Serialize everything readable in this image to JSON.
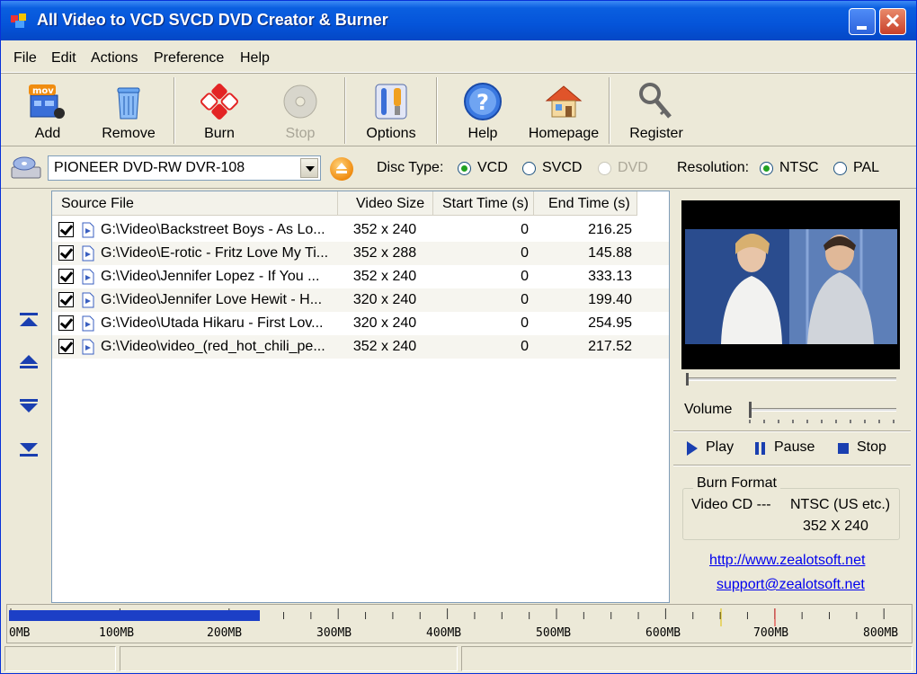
{
  "window": {
    "title": "All Video to VCD SVCD DVD Creator & Burner"
  },
  "menu": [
    {
      "label": "File"
    },
    {
      "label": "Edit"
    },
    {
      "label": "Actions"
    },
    {
      "label": "Preference"
    },
    {
      "label": "Help"
    }
  ],
  "toolbar": {
    "add": "Add",
    "remove": "Remove",
    "burn": "Burn",
    "stop": "Stop",
    "options": "Options",
    "help": "Help",
    "homepage": "Homepage",
    "register": "Register"
  },
  "drive": {
    "selected": "PIONEER  DVD-RW  DVR-108",
    "disc_type_label": "Disc Type:",
    "disc_types": [
      "VCD",
      "SVCD",
      "DVD"
    ],
    "disc_type_selected": "VCD",
    "resolution_label": "Resolution:",
    "resolutions": [
      "NTSC",
      "PAL"
    ],
    "resolution_selected": "NTSC"
  },
  "list": {
    "columns": [
      "Source File",
      "Video Size",
      "Start Time (s)",
      "End Time (s)"
    ],
    "rows": [
      {
        "source": "G:\\Video\\Backstreet Boys - As Lo...",
        "size": "352 x 240",
        "start": "0",
        "end": "216.25",
        "checked": true
      },
      {
        "source": "G:\\Video\\E-rotic - Fritz Love My Ti...",
        "size": "352 x 288",
        "start": "0",
        "end": "145.88",
        "checked": true
      },
      {
        "source": "G:\\Video\\Jennifer Lopez - If You ...",
        "size": "352 x 240",
        "start": "0",
        "end": "333.13",
        "checked": true
      },
      {
        "source": "G:\\Video\\Jennifer Love Hewit - H...",
        "size": "320 x 240",
        "start": "0",
        "end": "199.40",
        "checked": true
      },
      {
        "source": "G:\\Video\\Utada Hikaru - First Lov...",
        "size": "320 x 240",
        "start": "0",
        "end": "254.95",
        "checked": true
      },
      {
        "source": "G:\\Video\\video_(red_hot_chili_pe...",
        "size": "352 x 240",
        "start": "0",
        "end": "217.52",
        "checked": true
      }
    ]
  },
  "player": {
    "volume_label": "Volume",
    "play": "Play",
    "pause": "Pause",
    "stop": "Stop"
  },
  "burn_format": {
    "title": "Burn Format",
    "format": "Video CD ---",
    "standard": "NTSC (US etc.)",
    "resolution": "352 X 240"
  },
  "links": {
    "website": "http://www.zealotsoft.net",
    "support": "support@zealotsoft.net"
  },
  "capacity": {
    "labels": [
      "0MB",
      "100MB",
      "200MB",
      "300MB",
      "400MB",
      "500MB",
      "600MB",
      "700MB",
      "800MB"
    ],
    "used_mb": 230,
    "max_mb": 800
  },
  "colors": {
    "accent": "#1c3fc6",
    "titlebar": "#0554d9",
    "link": "#0000ee"
  }
}
